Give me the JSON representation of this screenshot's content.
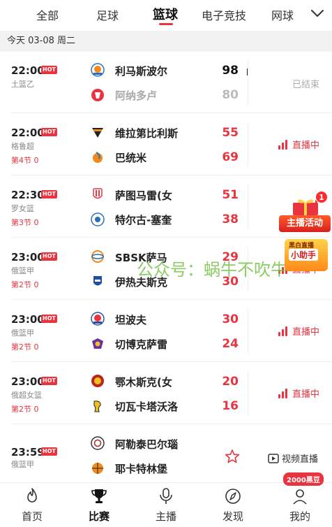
{
  "tabs": {
    "items": [
      {
        "label": "全部"
      },
      {
        "label": "足球"
      },
      {
        "label": "篮球"
      },
      {
        "label": "电子竞技"
      },
      {
        "label": "网球"
      }
    ],
    "active_index": 2
  },
  "date_bar": {
    "text": "今天 03-08 周二"
  },
  "matches": [
    {
      "time": "22:00",
      "hot": "HOT",
      "league": "土篮乙",
      "period": "",
      "home": "利马斯波尔",
      "away": "阿纳多卢",
      "home_score": "98",
      "away_score": "80",
      "status": "已结束",
      "status_type": "ended"
    },
    {
      "time": "22:00",
      "hot": "HOT",
      "league": "格鲁超",
      "period": "第4节 0",
      "home": "维拉第比利斯",
      "away": "巴统米",
      "home_score": "55",
      "away_score": "69",
      "status": "直播中",
      "status_type": "live"
    },
    {
      "time": "22:30",
      "hot": "HOT",
      "league": "罗女篮",
      "period": "第3节 0",
      "home": "萨图马雷(女",
      "away": "特尔古-塞奎",
      "home_score": "51",
      "away_score": "38",
      "status": "",
      "status_type": "live"
    },
    {
      "time": "23:00",
      "hot": "HOT",
      "league": "俄篮甲",
      "period": "第2节 0",
      "home": "SBSK萨马",
      "away": "伊热夫斯克",
      "home_score": "29",
      "away_score": "30",
      "status": "直播中",
      "status_type": "live"
    },
    {
      "time": "23:00",
      "hot": "HOT",
      "league": "俄篮甲",
      "period": "第2节 0",
      "home": "坦波夫",
      "away": "切博克萨雷",
      "home_score": "30",
      "away_score": "24",
      "status": "直播中",
      "status_type": "live"
    },
    {
      "time": "23:00",
      "hot": "HOT",
      "league": "俄超女篮",
      "period": "第2节 0",
      "home": "鄂木斯克(女",
      "away": "切瓦卡塔沃洛",
      "home_score": "20",
      "away_score": "16",
      "status": "直播中",
      "status_type": "live"
    },
    {
      "time": "23:59",
      "hot": "HOT",
      "league": "俄篮甲",
      "period": "",
      "home": "阿勒泰巴尔瑙",
      "away": "耶卡特林堡",
      "home_score": "",
      "away_score": "",
      "status": "视频直播",
      "status_type": "video"
    }
  ],
  "watermark": "公众号：蜗牛不吹牛",
  "promo": {
    "badge": "1",
    "main_label": "主播活动",
    "sub_title": "黑白直播",
    "sub_label": "小助手"
  },
  "bottom_nav": {
    "items": [
      {
        "label": "首页",
        "icon": "flame-icon"
      },
      {
        "label": "比赛",
        "icon": "trophy-icon"
      },
      {
        "label": "主播",
        "icon": "microphone-icon"
      },
      {
        "label": "发现",
        "icon": "compass-icon"
      },
      {
        "label": "我的",
        "icon": "user-icon"
      }
    ],
    "active_index": 1,
    "badge": "2000黑豆"
  },
  "colors": {
    "accent": "#e9343f",
    "muted": "#aaaaaa",
    "date_bg": "#f2f2f2"
  }
}
